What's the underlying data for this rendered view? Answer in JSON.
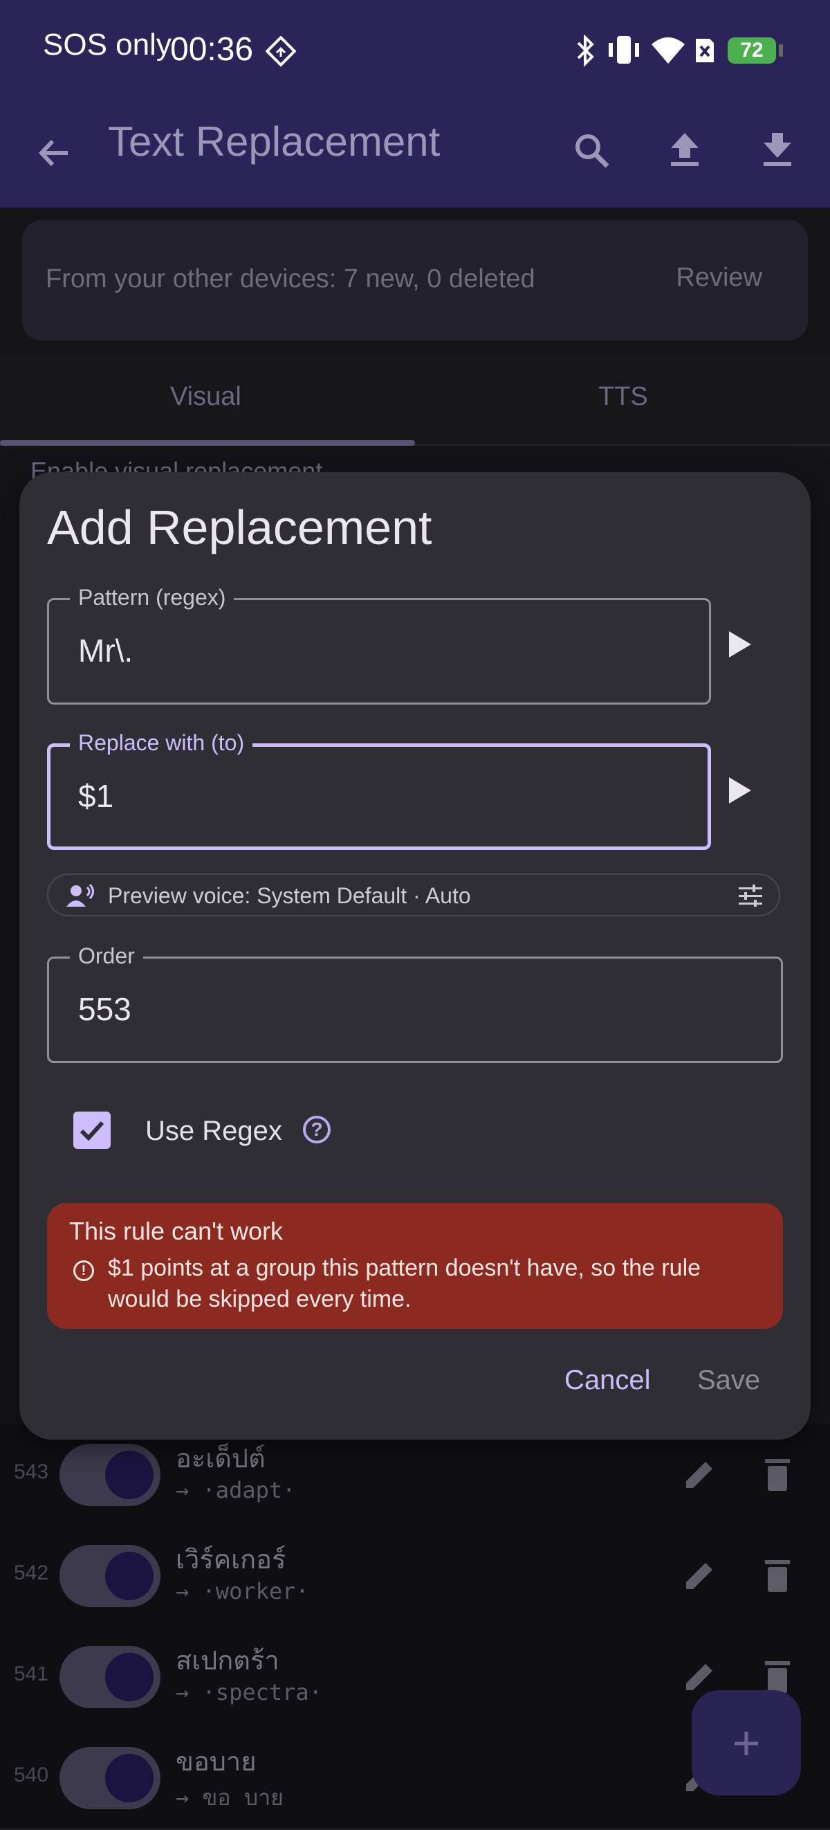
{
  "status_bar": {
    "carrier": "SOS only",
    "time": "00:36",
    "battery": "72"
  },
  "app_bar": {
    "title": "Text Replacement"
  },
  "sync_banner": {
    "text": "From your other devices: 7 new, 0 deleted",
    "action": "Review"
  },
  "tabs": [
    {
      "label": "Visual",
      "selected": true
    },
    {
      "label": "TTS",
      "selected": false
    }
  ],
  "partial_text": "Enable visual replacement",
  "rules": [
    {
      "order": "543",
      "from": "อะเด็ปต์",
      "to": "→ ·adapt·"
    },
    {
      "order": "542",
      "from": "เวิร์คเกอร์",
      "to": "→ ·worker·"
    },
    {
      "order": "541",
      "from": "สเปกตร้า",
      "to": "→ ·spectra·"
    },
    {
      "order": "540",
      "from": "ขอบาย",
      "to": "→ ขอ บาย"
    }
  ],
  "dialog": {
    "title": "Add Replacement",
    "pattern_label": "Pattern (regex)",
    "pattern_value": "Mr\\.",
    "replace_label": "Replace with (to)",
    "replace_value": "$1",
    "voice_preview": "Preview voice: System Default · Auto",
    "order_label": "Order",
    "order_value": "553",
    "use_regex_label": "Use Regex",
    "use_regex_checked": true,
    "error_title": "This rule can't work",
    "error_message": "$1 points at a group this pattern doesn't have, so the rule would be skipped every time.",
    "cancel_label": "Cancel",
    "save_label": "Save"
  },
  "colors": {
    "accent": "#cdbdff",
    "error_bg": "#8c2a21",
    "app_bar": "#2a2458"
  }
}
